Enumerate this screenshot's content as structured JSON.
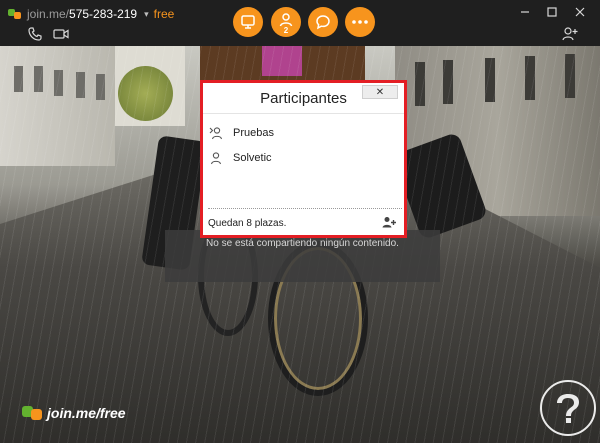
{
  "titlebar": {
    "domain": "join.me/",
    "meeting_code": "575-283-219",
    "caret": "▾",
    "plan": "free"
  },
  "toolbar": {
    "participants_count": "2"
  },
  "icons": {
    "phone": "phone-icon",
    "video": "video-camera-icon",
    "screen": "screen-share-icon",
    "participants": "participants-icon",
    "chat": "chat-bubble-icon",
    "more": "more-options-icon",
    "add_person": "add-person-icon",
    "minimize": "minimize-icon",
    "maximize": "maximize-icon",
    "close": "close-icon"
  },
  "stage": {
    "no_content": "No se está compartiendo ningún contenido."
  },
  "participants_panel": {
    "title": "Participantes",
    "close_label": "✕",
    "participants": [
      "Pruebas",
      "Solvetic"
    ],
    "seats_left": "Quedan 8 plazas."
  },
  "branding": {
    "logo_text": "join.me/free"
  },
  "colors": {
    "accent": "#f7941d",
    "brand_green": "#63b22f",
    "highlight_border": "#e31e24",
    "topbar_bg": "#1f1f1f"
  }
}
